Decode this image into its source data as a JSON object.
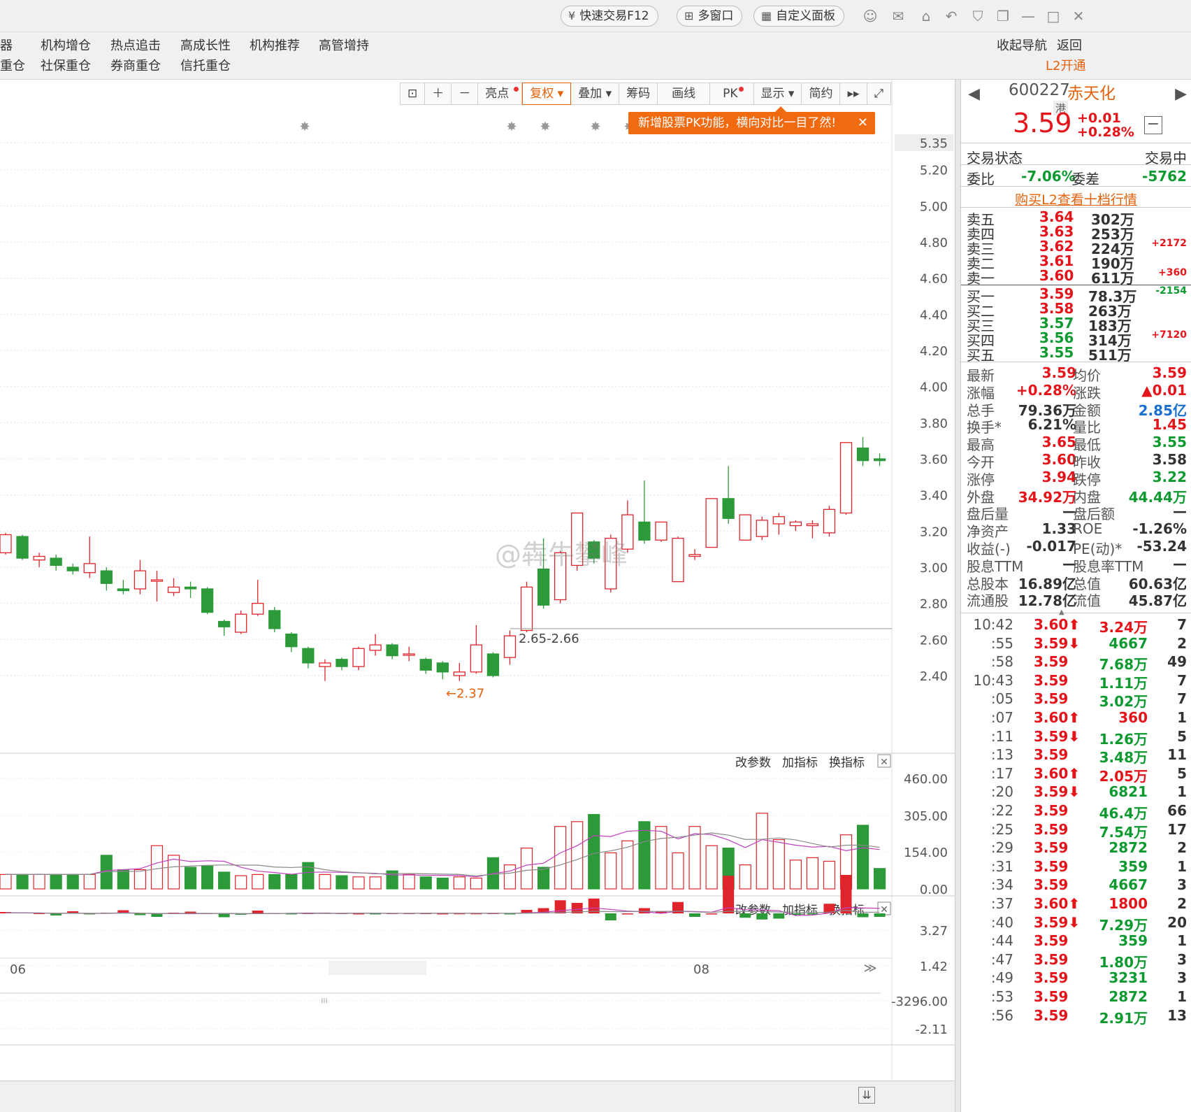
{
  "titlebar": {
    "quick_trade": "快速交易F12",
    "multi_window": "多窗口",
    "custom_panel": "自定义面板"
  },
  "menu": {
    "row1": [
      "器",
      "机构增仓",
      "热点追击",
      "高成长性",
      "机构推荐",
      "高管增持"
    ],
    "row2": [
      "重仓",
      "社保重仓",
      "券商重仓",
      "信托重仓"
    ],
    "nav": "收起导航",
    "back": "返回",
    "l2": "L2开通"
  },
  "toolbar": {
    "buttons": [
      "亮点",
      "复权",
      "叠加",
      "筹码",
      "画线",
      "PK",
      "显示",
      "简约"
    ],
    "tooltip": "新增股票PK功能，横向对比一目了然!"
  },
  "chart_data": {
    "type": "candlestick",
    "price_axis": [
      "5.35",
      "5.20",
      "5.00",
      "4.80",
      "4.60",
      "4.40",
      "4.20",
      "4.00",
      "3.80",
      "3.60",
      "3.40",
      "3.20",
      "3.00",
      "2.80",
      "2.60",
      "2.40"
    ],
    "annotations": {
      "low": "2.37",
      "range": "2.65-2.66"
    },
    "volume_axis": [
      "460.00",
      "305.00",
      "154.00",
      "0.00"
    ],
    "macd_axis": [
      "3.27",
      "1.42",
      "-3296.00",
      "-2.11"
    ],
    "x_labels": [
      "06",
      "08"
    ],
    "panel_links": [
      "改参数",
      "加指标",
      "换指标"
    ],
    "candles": [
      [
        3.08,
        3.18,
        3.19,
        3.07
      ],
      [
        3.17,
        3.05,
        3.18,
        3.04
      ],
      [
        3.04,
        3.06,
        3.08,
        3.0
      ],
      [
        3.05,
        3.01,
        3.07,
        2.98
      ],
      [
        3.0,
        2.98,
        3.02,
        2.96
      ],
      [
        2.97,
        3.02,
        3.17,
        2.94
      ],
      [
        2.98,
        2.91,
        3.0,
        2.87
      ],
      [
        2.88,
        2.87,
        2.93,
        2.85
      ],
      [
        2.88,
        2.98,
        3.04,
        2.85
      ],
      [
        2.93,
        2.93,
        2.98,
        2.81
      ],
      [
        2.86,
        2.89,
        2.94,
        2.84
      ],
      [
        2.89,
        2.88,
        2.92,
        2.83
      ],
      [
        2.88,
        2.75,
        2.89,
        2.74
      ],
      [
        2.7,
        2.67,
        2.71,
        2.62
      ],
      [
        2.64,
        2.74,
        2.76,
        2.63
      ],
      [
        2.74,
        2.8,
        2.93,
        2.73
      ],
      [
        2.76,
        2.66,
        2.78,
        2.64
      ],
      [
        2.63,
        2.56,
        2.64,
        2.53
      ],
      [
        2.55,
        2.47,
        2.56,
        2.44
      ],
      [
        2.45,
        2.47,
        2.49,
        2.37
      ],
      [
        2.49,
        2.45,
        2.5,
        2.43
      ],
      [
        2.45,
        2.55,
        2.56,
        2.43
      ],
      [
        2.54,
        2.57,
        2.63,
        2.51
      ],
      [
        2.57,
        2.51,
        2.58,
        2.49
      ],
      [
        2.52,
        2.52,
        2.56,
        2.48
      ],
      [
        2.49,
        2.43,
        2.5,
        2.41
      ],
      [
        2.47,
        2.42,
        2.48,
        2.38
      ],
      [
        2.4,
        2.42,
        2.47,
        2.37
      ],
      [
        2.42,
        2.57,
        2.68,
        2.41
      ],
      [
        2.52,
        2.4,
        2.53,
        2.39
      ],
      [
        2.5,
        2.62,
        2.65,
        2.46
      ],
      [
        2.65,
        2.89,
        2.92,
        2.64
      ],
      [
        2.99,
        2.79,
        3.16,
        2.77
      ],
      [
        2.82,
        3.08,
        3.09,
        2.8
      ],
      [
        3.01,
        3.3,
        3.3,
        2.98
      ],
      [
        3.14,
        3.05,
        3.15,
        3.02
      ],
      [
        2.88,
        3.16,
        3.18,
        2.86
      ],
      [
        3.1,
        3.29,
        3.37,
        3.08
      ],
      [
        3.25,
        3.15,
        3.48,
        3.13
      ],
      [
        3.15,
        3.25,
        3.25,
        3.14
      ],
      [
        2.92,
        3.16,
        3.17,
        2.92
      ],
      [
        3.06,
        3.07,
        3.1,
        3.04
      ],
      [
        3.11,
        3.38,
        3.38,
        3.11
      ],
      [
        3.38,
        3.27,
        3.56,
        3.24
      ],
      [
        3.15,
        3.29,
        3.29,
        3.15
      ],
      [
        3.17,
        3.26,
        3.28,
        3.15
      ],
      [
        3.24,
        3.28,
        3.3,
        3.18
      ],
      [
        3.23,
        3.25,
        3.26,
        3.2
      ],
      [
        3.23,
        3.24,
        3.26,
        3.16
      ],
      [
        3.19,
        3.32,
        3.34,
        3.17
      ],
      [
        3.3,
        3.69,
        3.69,
        3.29
      ],
      [
        3.66,
        3.59,
        3.72,
        3.56
      ],
      [
        3.6,
        3.59,
        3.63,
        3.56
      ]
    ],
    "volumes": [
      60,
      60,
      60,
      60,
      60,
      60,
      140,
      80,
      80,
      180,
      140,
      90,
      95,
      70,
      55,
      60,
      60,
      60,
      110,
      60,
      55,
      50,
      50,
      75,
      60,
      50,
      45,
      50,
      45,
      130,
      100,
      170,
      90,
      260,
      280,
      310,
      150,
      200,
      280,
      260,
      150,
      260,
      180,
      170,
      100,
      315,
      205,
      120,
      130,
      115,
      225,
      265,
      85
    ],
    "macd": [
      0.08,
      0.06,
      0.02,
      -0.12,
      0.12,
      -0.05,
      0.04,
      0.18,
      -0.1,
      -0.2,
      0.04,
      0.1,
      0.02,
      -0.22,
      -0.08,
      0.16,
      0.02,
      -0.04,
      0.02,
      0.04,
      0.02,
      0.0,
      -0.03,
      0.02,
      0.02,
      0.02,
      0.0,
      0.01,
      0.01,
      0.02,
      -0.02,
      0.2,
      0.3,
      0.75,
      0.6,
      0.85,
      -0.4,
      0.0,
      0.3,
      0.1,
      0.65,
      -0.2,
      0.0,
      2.15,
      -0.25,
      -0.35,
      -0.3,
      -0.08,
      -0.04,
      0.55,
      2.2,
      -0.22,
      -0.2
    ]
  },
  "stock": {
    "code": "600227",
    "name": "赤天化",
    "tag": "港",
    "price": "3.59",
    "change": "+0.01",
    "pct": "+0.28%",
    "status_label": "交易状态",
    "status": "交易中",
    "weibi_label": "委比",
    "weibi": "-7.06%",
    "weicha_label": "委差",
    "weicha": "-5762",
    "l2_link": "购买L2查看十档行情"
  },
  "asks": [
    {
      "label": "卖五",
      "price": "3.64",
      "vol": "302万",
      "delta": ""
    },
    {
      "label": "卖四",
      "price": "3.63",
      "vol": "253万",
      "delta": ""
    },
    {
      "label": "卖三",
      "price": "3.62",
      "vol": "224万",
      "delta": "+2172"
    },
    {
      "label": "卖二",
      "price": "3.61",
      "vol": "190万",
      "delta": ""
    },
    {
      "label": "卖一",
      "price": "3.60",
      "vol": "611万",
      "delta": "+360"
    }
  ],
  "bids": [
    {
      "label": "买一",
      "price": "3.59",
      "vol": "78.3万",
      "delta": "-2154"
    },
    {
      "label": "买二",
      "price": "3.58",
      "vol": "263万",
      "delta": ""
    },
    {
      "label": "买三",
      "price": "3.57",
      "vol": "183万",
      "delta": ""
    },
    {
      "label": "买四",
      "price": "3.56",
      "vol": "314万",
      "delta": "+7120"
    },
    {
      "label": "买五",
      "price": "3.55",
      "vol": "511万",
      "delta": ""
    }
  ],
  "stats": [
    [
      "最新",
      "3.59",
      "均价",
      "3.59"
    ],
    [
      "涨幅",
      "+0.28%",
      "涨跌",
      "▲0.01"
    ],
    [
      "总手",
      "79.36万",
      "金额",
      "2.85亿"
    ],
    [
      "换手*",
      "6.21%",
      "量比",
      "1.45"
    ],
    [
      "最高",
      "3.65",
      "最低",
      "3.55"
    ],
    [
      "今开",
      "3.60",
      "昨收",
      "3.58"
    ],
    [
      "涨停",
      "3.94",
      "跌停",
      "3.22"
    ],
    [
      "外盘",
      "34.92万",
      "内盘",
      "44.44万"
    ],
    [
      "盘后量",
      "—",
      "盘后额",
      "—"
    ],
    [
      "净资产",
      "1.33",
      "ROE",
      "-1.26%"
    ],
    [
      "收益(-)",
      "-0.017",
      "PE(动)*",
      "-53.24"
    ],
    [
      "股息TTM",
      "—",
      "股息率TTM",
      "—"
    ],
    [
      "总股本",
      "16.89亿",
      "总值",
      "60.63亿"
    ],
    [
      "流通股",
      "12.78亿",
      "流值",
      "45.87亿"
    ]
  ],
  "ticks": [
    [
      "10:42",
      "3.60⬆",
      "3.24万",
      "7"
    ],
    [
      ":55",
      "3.59⬇",
      "4667",
      "2"
    ],
    [
      ":58",
      "3.59",
      "7.68万",
      "49"
    ],
    [
      "10:43",
      "3.59",
      "1.11万",
      "7"
    ],
    [
      ":05",
      "3.59",
      "3.02万",
      "7"
    ],
    [
      ":07",
      "3.60⬆",
      "360",
      "1"
    ],
    [
      ":11",
      "3.59⬇",
      "1.26万",
      "5"
    ],
    [
      ":13",
      "3.59",
      "3.48万",
      "11"
    ],
    [
      ":17",
      "3.60⬆",
      "2.05万",
      "5"
    ],
    [
      ":20",
      "3.59⬇",
      "6821",
      "1"
    ],
    [
      ":22",
      "3.59",
      "46.4万",
      "66"
    ],
    [
      ":25",
      "3.59",
      "7.54万",
      "17"
    ],
    [
      ":29",
      "3.59",
      "2872",
      "2"
    ],
    [
      ":31",
      "3.59",
      "359",
      "1"
    ],
    [
      ":34",
      "3.59",
      "4667",
      "3"
    ],
    [
      ":37",
      "3.60⬆",
      "1800",
      "2"
    ],
    [
      ":40",
      "3.59⬇",
      "7.29万",
      "20"
    ],
    [
      ":44",
      "3.59",
      "359",
      "1"
    ],
    [
      ":47",
      "3.59",
      "1.80万",
      "3"
    ],
    [
      ":49",
      "3.59",
      "3231",
      "3"
    ],
    [
      ":53",
      "3.59",
      "2872",
      "1"
    ],
    [
      ":56",
      "3.59",
      "2.91万",
      "13"
    ]
  ],
  "watermark": "@犇牛攀峰"
}
